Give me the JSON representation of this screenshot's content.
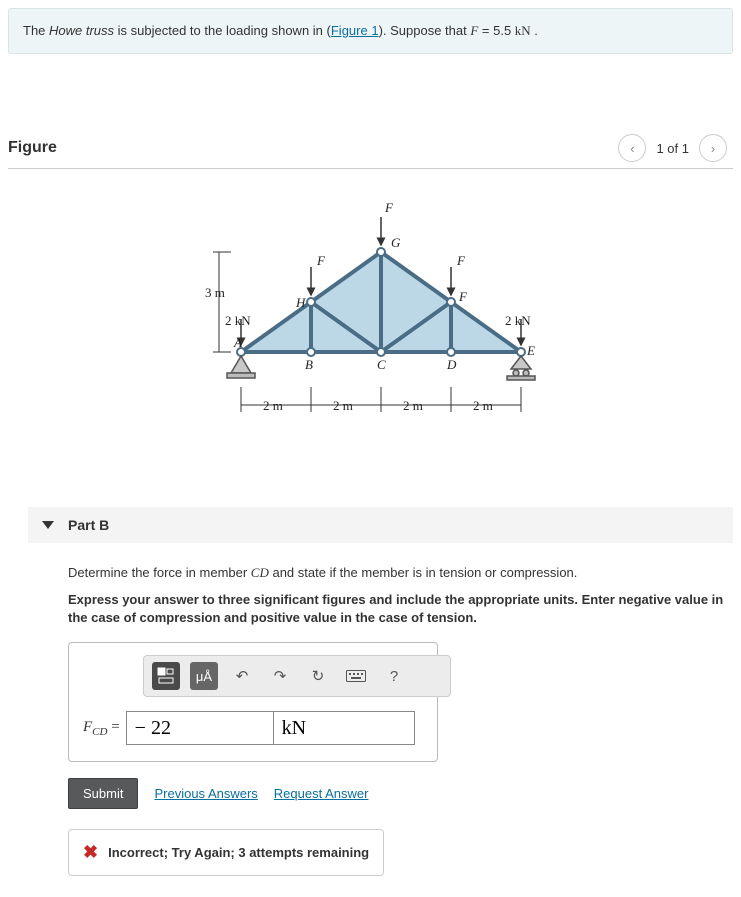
{
  "problem": {
    "prefix": "The ",
    "italic": "Howe truss",
    "mid": " is subjected to the loading shown in (",
    "figure_link": "Figure 1",
    "suffix": "). Suppose that ",
    "var": "F",
    "eq": " = 5.5 ",
    "unit": "kN",
    "period": " ."
  },
  "figure": {
    "title": "Figure",
    "pager": "1 of 1",
    "labels": {
      "F_top": "F",
      "G": "G",
      "F_left": "F",
      "F_right": "F",
      "F_slopeR": "F",
      "H": "H",
      "height": "3 m",
      "load_left": "2 kN",
      "load_right": "2 kN",
      "A": "A",
      "B": "B",
      "C": "C",
      "D": "D",
      "E": "E",
      "span1": "2 m",
      "span2": "2 m",
      "span3": "2 m",
      "span4": "2 m"
    }
  },
  "part": {
    "title": "Part B",
    "instruction_pre": "Determine the force in member ",
    "instruction_member": "CD",
    "instruction_post": " and state if the member is in tension or compression.",
    "note": "Express your answer to three significant figures and include the appropriate units. Enter negative value in the case of compression and positive value in the case of tension.",
    "toolbar": {
      "units_btn": "μÅ",
      "help": "?"
    },
    "lhs_sym": "F",
    "lhs_sub": "CD",
    "equals": " =",
    "value": "− 22",
    "unit": "kN",
    "submit": "Submit",
    "prev": "Previous Answers",
    "request": "Request Answer",
    "feedback": "Incorrect; Try Again; 3 attempts remaining"
  }
}
